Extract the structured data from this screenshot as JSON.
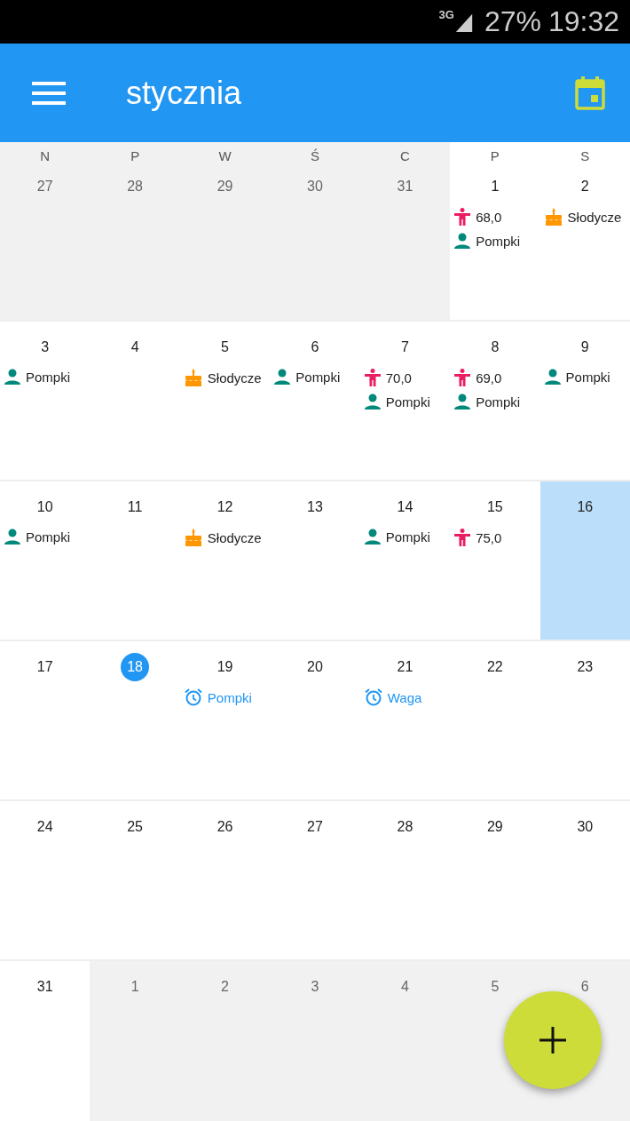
{
  "status_bar": {
    "network": "3G",
    "battery": "27%",
    "time": "19:32"
  },
  "app_bar": {
    "title": "stycznia"
  },
  "weekdays": [
    "N",
    "P",
    "W",
    "Ś",
    "C",
    "P",
    "S"
  ],
  "weeks": [
    [
      {
        "day": "27",
        "in_month": false,
        "selected": false,
        "today": false
      },
      {
        "day": "28",
        "in_month": false,
        "selected": false,
        "today": false
      },
      {
        "day": "29",
        "in_month": false,
        "selected": false,
        "today": false
      },
      {
        "day": "30",
        "in_month": false,
        "selected": false,
        "today": false
      },
      {
        "day": "31",
        "in_month": false,
        "selected": false,
        "today": false
      },
      {
        "day": "1",
        "in_month": true,
        "selected": false,
        "today": false,
        "events": [
          {
            "kind": "weight",
            "text": "68,0"
          },
          {
            "kind": "exercise",
            "text": "Pompki"
          }
        ]
      },
      {
        "day": "2",
        "in_month": true,
        "selected": false,
        "today": false,
        "events": [
          {
            "kind": "sweets",
            "text": "Słodycze"
          }
        ]
      }
    ],
    [
      {
        "day": "3",
        "in_month": true,
        "selected": false,
        "today": false,
        "events": [
          {
            "kind": "exercise",
            "text": "Pompki"
          }
        ]
      },
      {
        "day": "4",
        "in_month": true,
        "selected": false,
        "today": false
      },
      {
        "day": "5",
        "in_month": true,
        "selected": false,
        "today": false,
        "events": [
          {
            "kind": "sweets",
            "text": "Słodycze"
          }
        ]
      },
      {
        "day": "6",
        "in_month": true,
        "selected": false,
        "today": false,
        "events": [
          {
            "kind": "exercise",
            "text": "Pompki"
          }
        ]
      },
      {
        "day": "7",
        "in_month": true,
        "selected": false,
        "today": false,
        "events": [
          {
            "kind": "weight",
            "text": "70,0"
          },
          {
            "kind": "exercise",
            "text": "Pompki"
          }
        ]
      },
      {
        "day": "8",
        "in_month": true,
        "selected": false,
        "today": false,
        "events": [
          {
            "kind": "weight",
            "text": "69,0"
          },
          {
            "kind": "exercise",
            "text": "Pompki"
          }
        ]
      },
      {
        "day": "9",
        "in_month": true,
        "selected": false,
        "today": false,
        "events": [
          {
            "kind": "exercise",
            "text": "Pompki"
          }
        ]
      }
    ],
    [
      {
        "day": "10",
        "in_month": true,
        "selected": false,
        "today": false,
        "events": [
          {
            "kind": "exercise",
            "text": "Pompki"
          }
        ]
      },
      {
        "day": "11",
        "in_month": true,
        "selected": false,
        "today": false
      },
      {
        "day": "12",
        "in_month": true,
        "selected": false,
        "today": false,
        "events": [
          {
            "kind": "sweets",
            "text": "Słodycze"
          }
        ]
      },
      {
        "day": "13",
        "in_month": true,
        "selected": false,
        "today": false
      },
      {
        "day": "14",
        "in_month": true,
        "selected": false,
        "today": false,
        "events": [
          {
            "kind": "exercise",
            "text": "Pompki"
          }
        ]
      },
      {
        "day": "15",
        "in_month": true,
        "selected": false,
        "today": false,
        "events": [
          {
            "kind": "weight",
            "text": "75,0"
          }
        ]
      },
      {
        "day": "16",
        "in_month": true,
        "selected": true,
        "today": false
      }
    ],
    [
      {
        "day": "17",
        "in_month": true,
        "selected": false,
        "today": false
      },
      {
        "day": "18",
        "in_month": true,
        "selected": false,
        "today": true
      },
      {
        "day": "19",
        "in_month": true,
        "selected": false,
        "today": false,
        "events": [
          {
            "kind": "reminder",
            "text": "Pompki"
          }
        ]
      },
      {
        "day": "20",
        "in_month": true,
        "selected": false,
        "today": false
      },
      {
        "day": "21",
        "in_month": true,
        "selected": false,
        "today": false,
        "events": [
          {
            "kind": "reminder",
            "text": "Waga"
          }
        ]
      },
      {
        "day": "22",
        "in_month": true,
        "selected": false,
        "today": false
      },
      {
        "day": "23",
        "in_month": true,
        "selected": false,
        "today": false
      }
    ],
    [
      {
        "day": "24",
        "in_month": true,
        "selected": false,
        "today": false
      },
      {
        "day": "25",
        "in_month": true,
        "selected": false,
        "today": false
      },
      {
        "day": "26",
        "in_month": true,
        "selected": false,
        "today": false
      },
      {
        "day": "27",
        "in_month": true,
        "selected": false,
        "today": false
      },
      {
        "day": "28",
        "in_month": true,
        "selected": false,
        "today": false
      },
      {
        "day": "29",
        "in_month": true,
        "selected": false,
        "today": false
      },
      {
        "day": "30",
        "in_month": true,
        "selected": false,
        "today": false
      }
    ],
    [
      {
        "day": "31",
        "in_month": true,
        "selected": false,
        "today": false
      },
      {
        "day": "1",
        "in_month": false,
        "selected": false,
        "today": false
      },
      {
        "day": "2",
        "in_month": false,
        "selected": false,
        "today": false
      },
      {
        "day": "3",
        "in_month": false,
        "selected": false,
        "today": false
      },
      {
        "day": "4",
        "in_month": false,
        "selected": false,
        "today": false
      },
      {
        "day": "5",
        "in_month": false,
        "selected": false,
        "today": false
      },
      {
        "day": "6",
        "in_month": false,
        "selected": false,
        "today": false
      }
    ]
  ]
}
